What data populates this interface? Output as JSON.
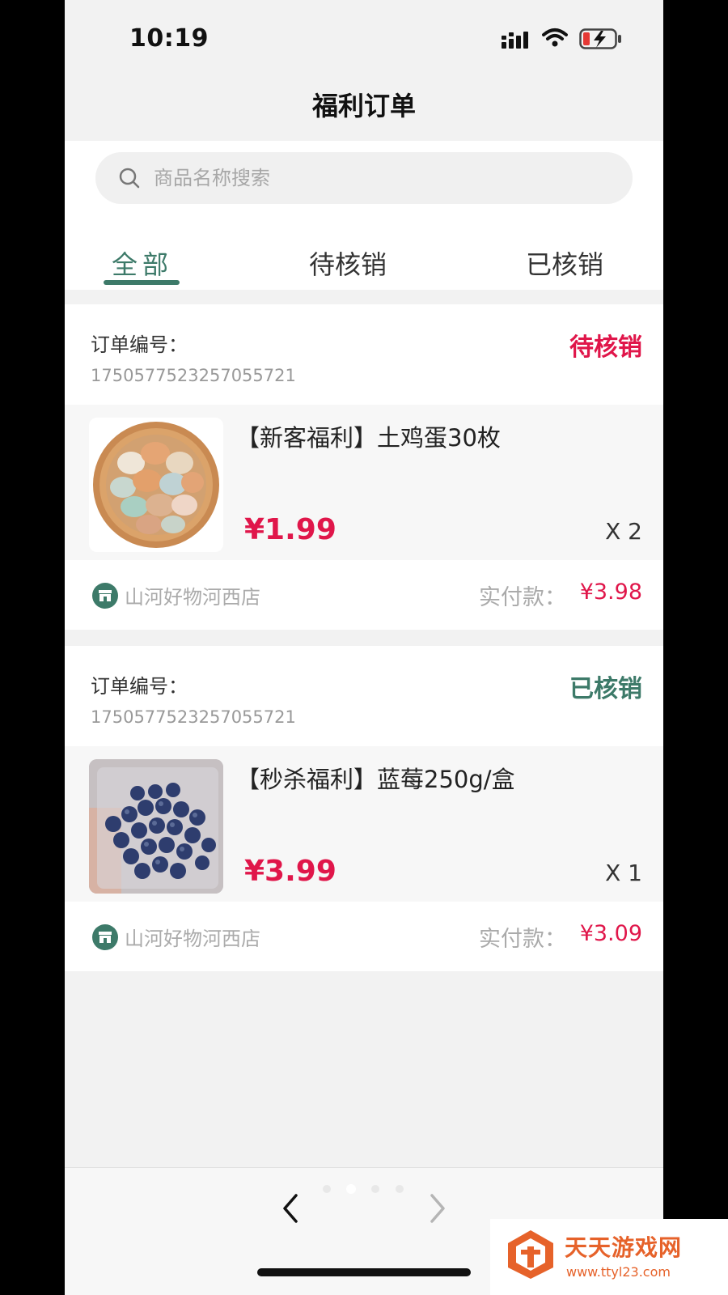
{
  "status_bar": {
    "time": "10:19"
  },
  "nav": {
    "title": "福利订单"
  },
  "search": {
    "placeholder": "商品名称搜索"
  },
  "tabs": [
    {
      "label": "全部",
      "active": true
    },
    {
      "label": "待核销",
      "active": false
    },
    {
      "label": "已核销",
      "active": false
    }
  ],
  "orders": [
    {
      "order_no_label": "订单编号：",
      "order_no": "1750577523257055721",
      "status": "待核销",
      "status_color": "#e0164a",
      "product_name": "【新客福利】土鸡蛋30枚",
      "image": "egg-basket-image",
      "price": "¥1.99",
      "qty": "X 2",
      "shop_icon": "store-icon",
      "shop_name": "山河好物河西店",
      "paid_label": "实付款：",
      "paid_amount": "¥3.98"
    },
    {
      "order_no_label": "订单编号：",
      "order_no": "1750577523257055721",
      "status": "已核销",
      "status_color": "#3d7a69",
      "product_name": "【秒杀福利】蓝莓250g/盒",
      "image": "blueberries-image",
      "price": "¥3.99",
      "qty": "X 1",
      "shop_icon": "store-icon",
      "shop_name": "山河好物河西店",
      "paid_label": "实付款：",
      "paid_amount": "¥3.09"
    }
  ],
  "watermark": {
    "title": "天天游戏网",
    "url": "www.ttyl23.com"
  },
  "colors": {
    "accent": "#3d7a69",
    "price": "#e0164a"
  }
}
